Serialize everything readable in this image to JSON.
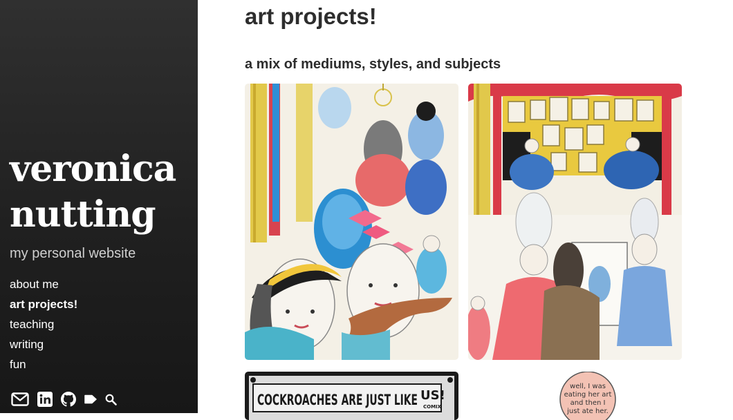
{
  "sidebar": {
    "title_line1": "veronica",
    "title_line2": "nutting",
    "tagline": "my personal website",
    "nav": [
      {
        "label": "about me",
        "active": false
      },
      {
        "label": "art projects!",
        "active": true
      },
      {
        "label": "teaching",
        "active": false
      },
      {
        "label": "writing",
        "active": false
      },
      {
        "label": "fun",
        "active": false
      }
    ],
    "icons": [
      "mail-icon",
      "linkedin-icon",
      "github-icon",
      "tag-icon",
      "search-icon"
    ]
  },
  "main": {
    "title": "art projects!",
    "subtitle": "a mix of mediums, styles, and subjects",
    "tiles": [
      {
        "name": "artwork-tile-versailles-portraits"
      },
      {
        "name": "artwork-tile-gallery-painting"
      },
      {
        "name": "artwork-tile-cockroaches-comic",
        "caption_main": "COCKROACHES ARE JUST LIKE",
        "caption_badge": "US!",
        "caption_small": "COMIX"
      },
      {
        "name": "artwork-tile-speech-bubble",
        "bubble_lines": [
          "well, I was",
          "eating her art",
          "and then I",
          "just ate her."
        ]
      }
    ]
  },
  "colors": {
    "sidebar_bg": "#222222",
    "text_dark": "#2d2d2d",
    "tagline": "#cfcfcf"
  }
}
